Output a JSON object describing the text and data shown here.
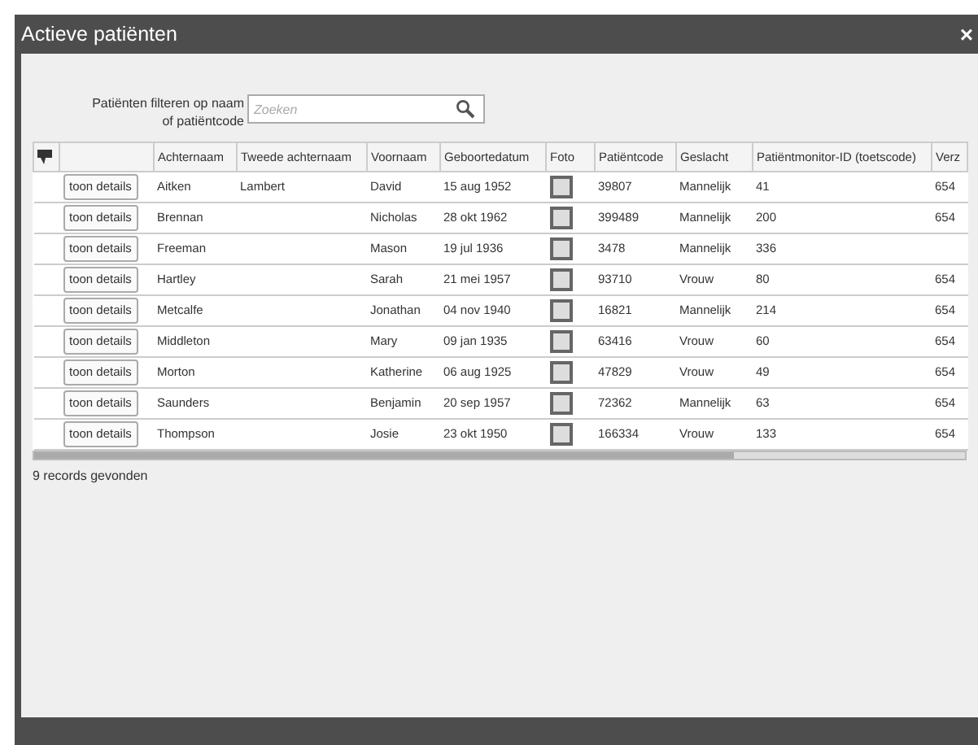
{
  "window": {
    "title": "Actieve patiënten",
    "close": "×"
  },
  "filter": {
    "label": "Patiënten filteren op naam of patiëntcode",
    "placeholder": "Zoeken"
  },
  "table": {
    "columns": [
      "Achternaam",
      "Tweede achternaam",
      "Voornaam",
      "Geboortedatum",
      "Foto",
      "Patiëntcode",
      "Geslacht",
      "Patiëntmonitor-ID (toetscode)",
      "Verz"
    ],
    "rows": [
      {
        "button": "toon details",
        "last": "Aitken",
        "second": "Lambert",
        "first": "David",
        "dob": "15 aug 1952",
        "code": "39807",
        "sex": "Mannelijk",
        "monitor": "41",
        "column_9": "654"
      },
      {
        "button": "toon details",
        "last": "Brennan",
        "second": "",
        "first": "Nicholas",
        "dob": "28 okt 1962",
        "code": "399489",
        "sex": "Mannelijk",
        "monitor": "200",
        "column_9": "654"
      },
      {
        "button": "toon details",
        "last": "Freeman",
        "second": "",
        "first": "Mason",
        "dob": "19 jul 1936",
        "code": "3478",
        "sex": "Mannelijk",
        "monitor": "336",
        "column_9": ""
      },
      {
        "button": "toon details",
        "last": "Hartley",
        "second": "",
        "first": "Sarah",
        "dob": "21 mei 1957",
        "code": "93710",
        "sex": "Vrouw",
        "monitor": "80",
        "column_9": "654"
      },
      {
        "button": "toon details",
        "last": "Metcalfe",
        "second": "",
        "first": "Jonathan",
        "dob": "04 nov 1940",
        "code": "16821",
        "sex": "Mannelijk",
        "monitor": "214",
        "column_9": "654"
      },
      {
        "button": "toon details",
        "last": "Middleton",
        "second": "",
        "first": "Mary",
        "dob": "09 jan 1935",
        "code": "63416",
        "sex": "Vrouw",
        "monitor": "60",
        "column_9": "654"
      },
      {
        "button": "toon details",
        "last": "Morton",
        "second": "",
        "first": "Katherine",
        "dob": "06 aug 1925",
        "code": "47829",
        "sex": "Vrouw",
        "monitor": "49",
        "column_9": "654"
      },
      {
        "button": "toon details",
        "last": "Saunders",
        "second": "",
        "first": "Benjamin",
        "dob": "20 sep 1957",
        "code": "72362",
        "sex": "Mannelijk",
        "monitor": "63",
        "column_9": "654"
      },
      {
        "button": "toon details",
        "last": "Thompson",
        "second": "",
        "first": "Josie",
        "dob": "23 okt 1950",
        "code": "166334",
        "sex": "Vrouw",
        "monitor": "133",
        "column_9": "654"
      }
    ]
  },
  "status": "9 records gevonden"
}
